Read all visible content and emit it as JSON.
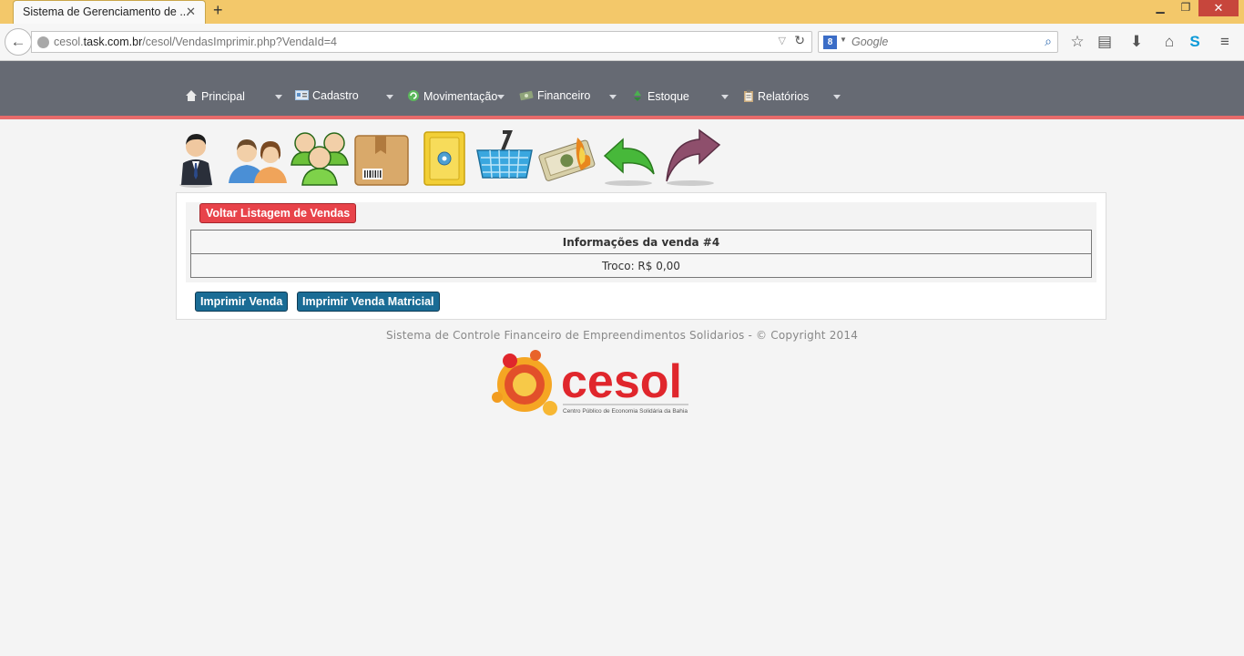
{
  "browser": {
    "tab_title": "Sistema de Gerenciamento de ...",
    "url_domain_prefix": "cesol.",
    "url_domain": "task.com.br",
    "url_path": "/cesol/VendasImprimir.php?VendaId=4",
    "search_placeholder": "Google",
    "search_engine_letter": "8"
  },
  "menu": {
    "items": [
      {
        "label": "Principal",
        "icon": "home-icon",
        "color": "#e8e8e8"
      },
      {
        "label": "Cadastro",
        "icon": "card-icon",
        "color": "#9fc3e6"
      },
      {
        "label": "Movimentação",
        "icon": "refresh-icon",
        "color": "#5cb85c"
      },
      {
        "label": "Financeiro",
        "icon": "money-icon",
        "color": "#9aa88a"
      },
      {
        "label": "Estoque",
        "icon": "recycle-icon",
        "color": "#4caf50"
      },
      {
        "label": "Relatórios",
        "icon": "clipboard-icon",
        "color": "#c8a87a"
      }
    ]
  },
  "shortcuts": [
    "businessman-icon",
    "users-icon",
    "group-icon",
    "package-icon",
    "safe-icon",
    "basket-icon",
    "cash-icon",
    "undo-arrow-icon",
    "redo-arrow-icon"
  ],
  "main": {
    "back_button_label": "Voltar Listagem de Vendas",
    "table_header": "Informações da venda #4",
    "table_row": "Troco: R$ 0,00",
    "print_button_label": "Imprimir Venda",
    "print_matrix_button_label": "Imprimir Venda Matricial"
  },
  "footer": {
    "copyright": "Sistema de Controle Financeiro de Empreendimentos Solidarios - © Copyright 2014",
    "logo_text": "cesol",
    "logo_subtitle": "Centro Público de Economia Solidária da Bahia"
  },
  "colors": {
    "header_bg": "#666a73",
    "header_accent": "#e86b6b",
    "button_red": "#e8434a",
    "button_blue": "#1a6c95",
    "logo_red": "#e0262c",
    "logo_orange": "#f39c1e"
  }
}
